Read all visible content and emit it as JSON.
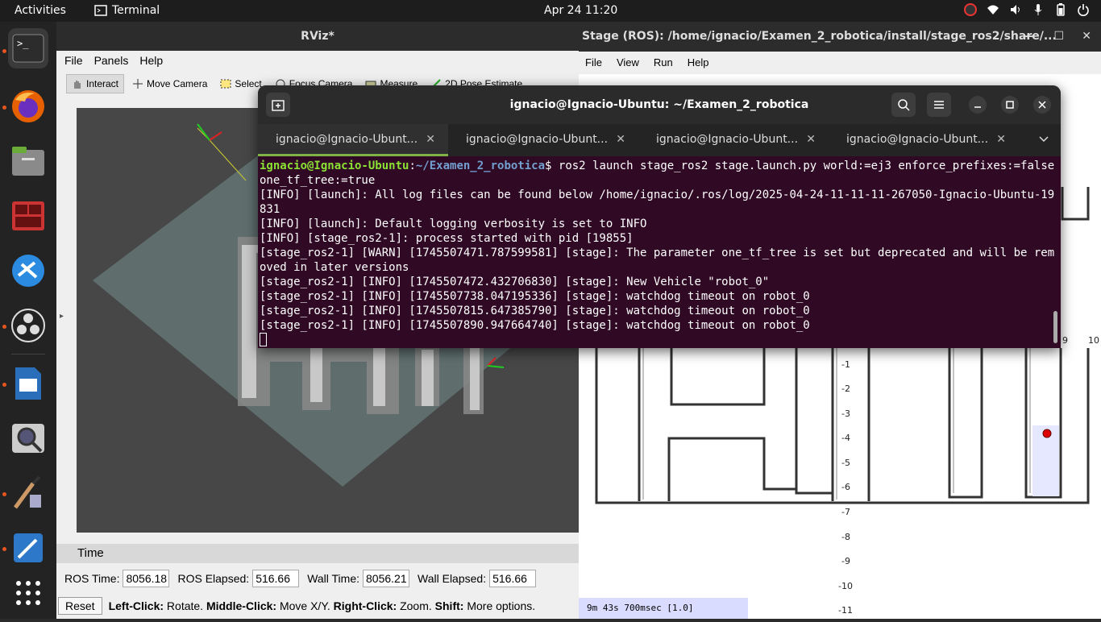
{
  "topbar": {
    "activities": "Activities",
    "app_name": "Terminal",
    "clock": "Apr 24  11:20"
  },
  "rviz": {
    "title": "RViz*",
    "menu": [
      "File",
      "Panels",
      "Help"
    ],
    "tools": [
      "Interact",
      "Move Camera",
      "Select",
      "Focus Camera",
      "Measure",
      "2D Pose Estimate"
    ],
    "time_panel": {
      "header": "Time",
      "ros_time_label": "ROS Time:",
      "ros_time": "8056.18",
      "ros_elapsed_label": "ROS Elapsed:",
      "ros_elapsed": "516.66",
      "wall_time_label": "Wall Time:",
      "wall_time": "8056.21",
      "wall_elapsed_label": "Wall Elapsed:",
      "wall_elapsed": "516.66",
      "reset": "Reset",
      "hint_l_b": "Left-Click:",
      "hint_l": " Rotate. ",
      "hint_m_b": "Middle-Click:",
      "hint_m": " Move X/Y. ",
      "hint_r_b": "Right-Click:",
      "hint_r": " Zoom. ",
      "hint_s_b": "Shift:",
      "hint_s": " More options."
    }
  },
  "stage": {
    "title": "Stage (ROS): /home/ignacio/Examen_2_robotica/install/stage_ros2/share/...",
    "menu": [
      "File",
      "View",
      "Run",
      "Help"
    ],
    "status": "9m 43s 700msec [1.0]",
    "axis_y": [
      "-1",
      "-2",
      "-3",
      "-4",
      "-5",
      "-6",
      "-7",
      "-8",
      "-9",
      "-10",
      "-11"
    ],
    "axis_x": [
      "9",
      "10"
    ]
  },
  "terminal": {
    "title": "ignacio@Ignacio-Ubuntu: ~/Examen_2_robotica",
    "tabs": [
      "ignacio@Ignacio-Ubunt...",
      "ignacio@Ignacio-Ubunt...",
      "ignacio@Ignacio-Ubunt...",
      "ignacio@Ignacio-Ubunt..."
    ],
    "prompt_user": "ignacio@Ignacio-Ubuntu",
    "prompt_path": "~/Examen_2_robotica",
    "command": "$ ros2 launch stage_ros2 stage.launch.py world:=ej3 enforce_prefixes:=false one_tf_tree:=true",
    "lines": [
      "[INFO] [launch]: All log files can be found below /home/ignacio/.ros/log/2025-04-24-11-11-11-267050-Ignacio-Ubuntu-19831",
      "[INFO] [launch]: Default logging verbosity is set to INFO",
      "[INFO] [stage_ros2-1]: process started with pid [19855]",
      "[stage_ros2-1] [WARN] [1745507471.787599581] [stage]: The parameter one_tf_tree is set but deprecated and will be removed in later versions",
      "[stage_ros2-1] [INFO] [1745507472.432706830] [stage]: New Vehicle \"robot_0\"",
      "[stage_ros2-1] [INFO] [1745507738.047195336] [stage]: watchdog timeout on robot_0",
      "[stage_ros2-1] [INFO] [1745507815.647385790] [stage]: watchdog timeout on robot_0",
      "[stage_ros2-1] [INFO] [1745507890.947664740] [stage]: watchdog timeout on robot_0"
    ]
  }
}
